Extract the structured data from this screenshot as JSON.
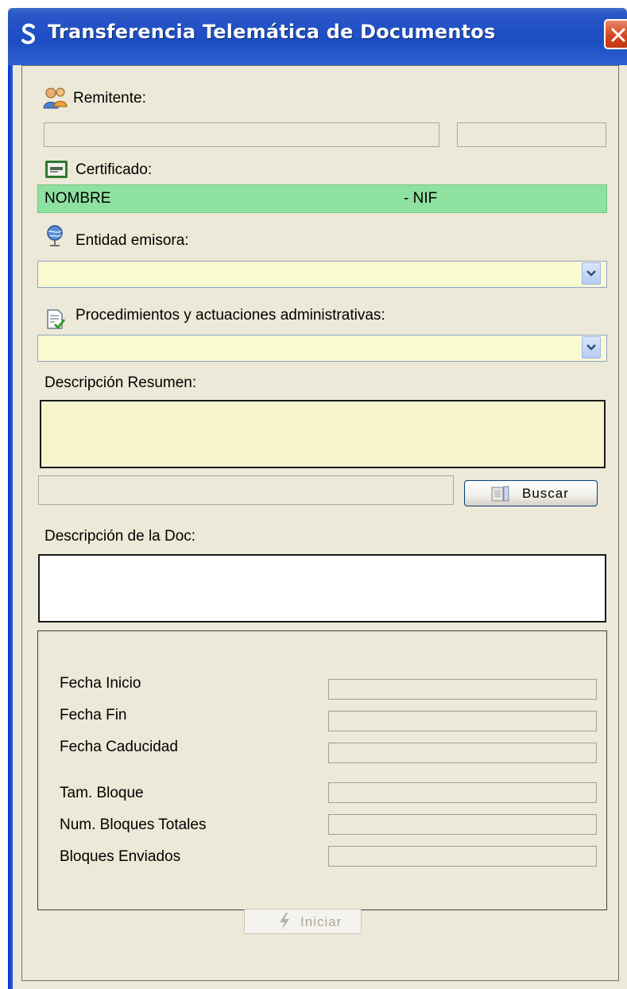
{
  "window": {
    "title": "Transferencia Telemática de Documentos",
    "title_color": "#ffffff",
    "titlebar_color": "#1f4fc4"
  },
  "remitente": {
    "label": "Remitente:",
    "icon": "users-icon",
    "field1_value": "",
    "field2_value": ""
  },
  "certificado": {
    "label": "Certificado:",
    "icon": "certificate-icon",
    "name": "NOMBRE",
    "nif": "- NIF",
    "background": "#8fe1a0"
  },
  "entidad": {
    "label": "Entidad emisora:",
    "icon": "globe-icon",
    "selected": ""
  },
  "procedimientos": {
    "label": "Procedimientos y actuaciones administrativas:",
    "icon": "document-check-icon",
    "selected": ""
  },
  "descripcion_resumen": {
    "label": "Descripción Resumen:",
    "value": "",
    "background": "#f7f4cd"
  },
  "archivo": {
    "value": "",
    "buscar_label": "Buscar"
  },
  "descripcion_doc": {
    "label": "Descripción de la Doc:",
    "value": ""
  },
  "info": {
    "fecha_inicio_label": "Fecha Inicio",
    "fecha_fin_label": "Fecha Fin",
    "fecha_caducidad_label": "Fecha Caducidad",
    "tam_bloque_label": "Tam. Bloque",
    "num_bloques_label": "Num. Bloques Totales",
    "bloques_enviados_label": "Bloques Enviados",
    "fecha_inicio_value": "",
    "fecha_fin_value": "",
    "fecha_caducidad_value": "",
    "tam_bloque_value": "",
    "num_bloques_value": "",
    "bloques_enviados_value": ""
  },
  "iniciar": {
    "label": "Iniciar",
    "enabled": false
  }
}
